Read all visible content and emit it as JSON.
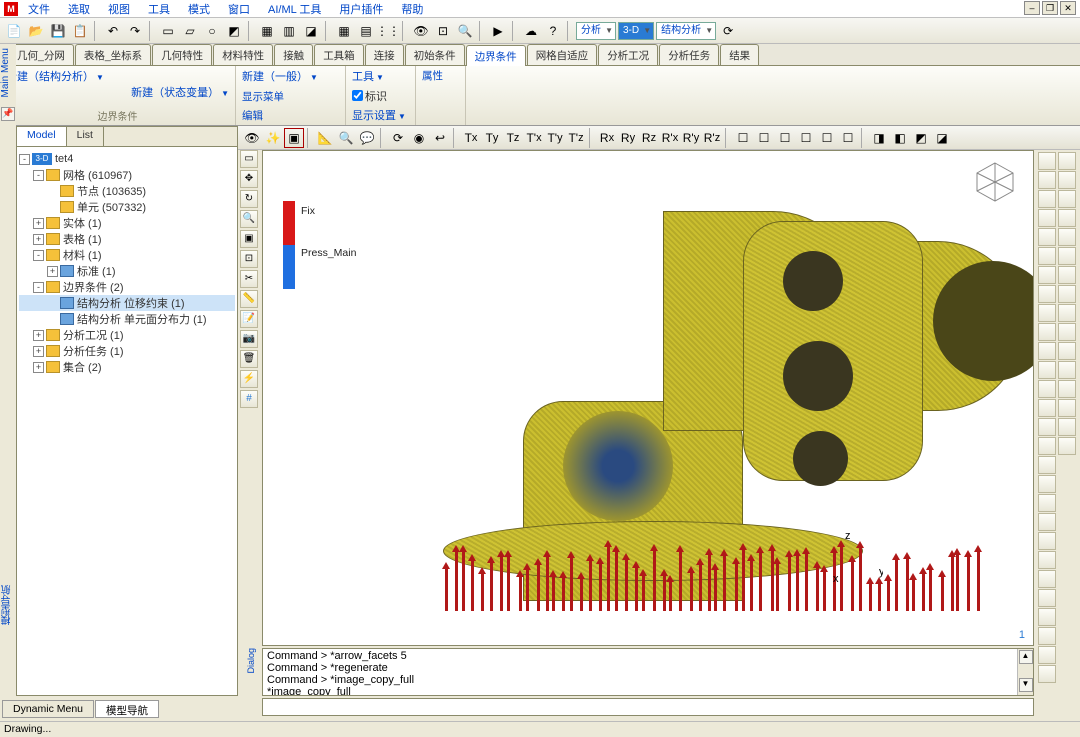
{
  "menu": [
    "文件",
    "选取",
    "视图",
    "工具",
    "模式",
    "窗口",
    "AI/ML 工具",
    "用户插件",
    "帮助"
  ],
  "tabs": [
    "几何_分网",
    "表格_坐标系",
    "几何特性",
    "材料特性",
    "接触",
    "工具箱",
    "连接",
    "初始条件",
    "边界条件",
    "网格自适应",
    "分析工况",
    "分析任务",
    "结果"
  ],
  "active_tab": "边界条件",
  "ribbon": {
    "g1": {
      "new_struct": "新建（结构分析）",
      "new_state": "新建（状态变量）",
      "new_general": "新建（一般）",
      "show_menu": "显示菜单",
      "edit": "编辑",
      "tools": "工具",
      "mark": "标识",
      "show_settings": "显示设置",
      "props": "属性",
      "title": "边界条件"
    }
  },
  "toolbar2_combos": {
    "analysis": "分析",
    "mode": "3-D",
    "struct": "结构分析"
  },
  "leftpanel": {
    "tabs": [
      "Model",
      "List"
    ],
    "tree": [
      {
        "depth": 0,
        "exp": "-",
        "icon": "badge3d",
        "label": "tet4"
      },
      {
        "depth": 1,
        "exp": "-",
        "icon": "folder",
        "label": "网格 (610967)"
      },
      {
        "depth": 2,
        "exp": "",
        "icon": "folder",
        "label": "节点 (103635)"
      },
      {
        "depth": 2,
        "exp": "",
        "icon": "folder",
        "label": "单元 (507332)"
      },
      {
        "depth": 1,
        "exp": "+",
        "icon": "folderc",
        "label": "实体 (1)"
      },
      {
        "depth": 1,
        "exp": "+",
        "icon": "folderc",
        "label": "表格 (1)"
      },
      {
        "depth": 1,
        "exp": "-",
        "icon": "folderc",
        "label": "材料 (1)"
      },
      {
        "depth": 2,
        "exp": "+",
        "icon": "node",
        "label": "标准 (1)"
      },
      {
        "depth": 1,
        "exp": "-",
        "icon": "folderc",
        "label": "边界条件 (2)"
      },
      {
        "depth": 2,
        "exp": "",
        "icon": "node",
        "label": "结构分析 位移约束 (1)",
        "sel": true
      },
      {
        "depth": 2,
        "exp": "",
        "icon": "node",
        "label": "结构分析 单元面分布力 (1)"
      },
      {
        "depth": 1,
        "exp": "+",
        "icon": "folderc",
        "label": "分析工况 (1)"
      },
      {
        "depth": 1,
        "exp": "+",
        "icon": "folderc",
        "label": "分析任务 (1)"
      },
      {
        "depth": 1,
        "exp": "+",
        "icon": "folderc",
        "label": "集合 (2)"
      }
    ]
  },
  "legend": [
    {
      "color": "red",
      "label": "Fix"
    },
    {
      "color": "blue",
      "label": "Press_Main"
    }
  ],
  "axis": {
    "x": "x",
    "y": "y",
    "z": "z"
  },
  "viewport_number": "1",
  "commands": [
    "Command > *arrow_facets 5",
    "Command > *regenerate",
    "Command > *image_copy_full",
    "*image_copy_full"
  ],
  "bottom_tabs": [
    "Dynamic Menu",
    "模型导航"
  ],
  "status": "Drawing...",
  "left_rail": {
    "label": "Main Menu"
  },
  "dialog_rail": "Dialog",
  "left_rail2": "模型导航"
}
